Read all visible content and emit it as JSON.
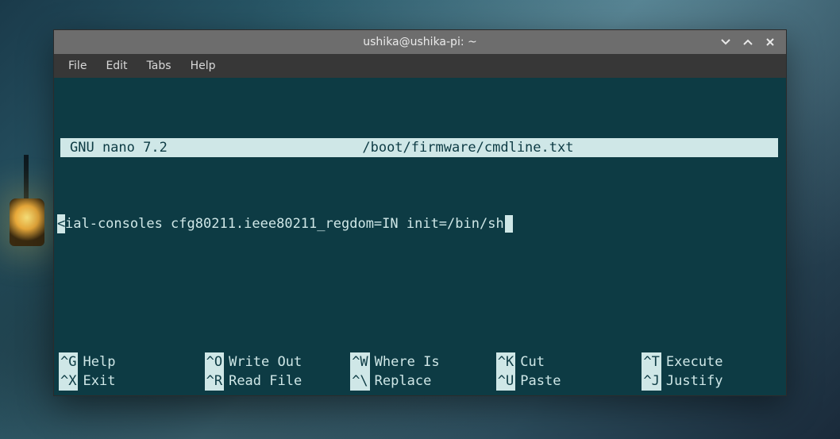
{
  "window": {
    "title": "ushika@ushika-pi: ~"
  },
  "menubar": {
    "items": [
      "File",
      "Edit",
      "Tabs",
      "Help"
    ]
  },
  "nano": {
    "app_label": "GNU nano 7.2",
    "file_path": "/boot/firmware/cmdline.txt",
    "scroll_indicator": "<",
    "content_line": "ial-consoles cfg80211.ieee80211_regdom=IN init=/bin/sh"
  },
  "shortcuts": [
    {
      "key": "^G",
      "label": "Help"
    },
    {
      "key": "^X",
      "label": "Exit"
    },
    {
      "key": "^O",
      "label": "Write Out"
    },
    {
      "key": "^R",
      "label": "Read File"
    },
    {
      "key": "^W",
      "label": "Where Is"
    },
    {
      "key": "^\\",
      "label": "Replace"
    },
    {
      "key": "^K",
      "label": "Cut"
    },
    {
      "key": "^U",
      "label": "Paste"
    },
    {
      "key": "^T",
      "label": "Execute"
    },
    {
      "key": "^J",
      "label": "Justify"
    }
  ]
}
